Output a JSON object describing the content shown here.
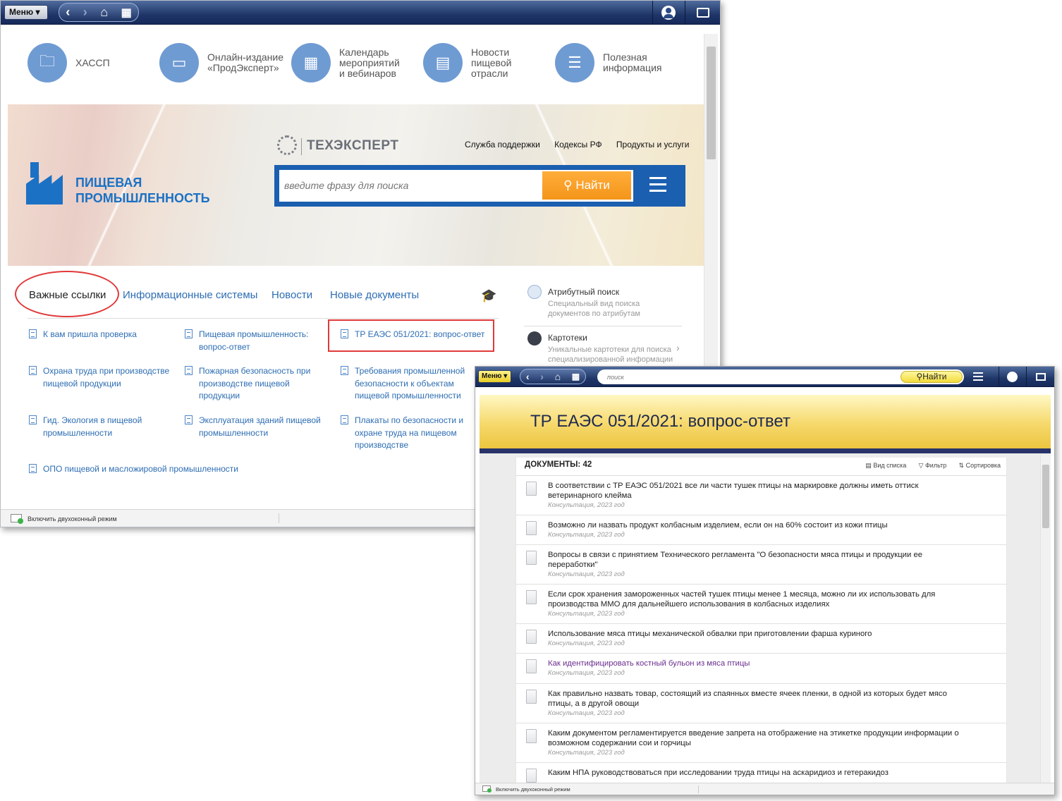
{
  "main_window": {
    "toolbar": {
      "menu_label": "Меню ▾",
      "back": "<",
      "forward": ">",
      "home": "⌂",
      "apps": "▦"
    },
    "tiles": [
      {
        "label": "ХАССП",
        "icon": "folders-icon"
      },
      {
        "label": "Онлайн-издание\n«ПродЭксперт»",
        "icon": "monitor-icon"
      },
      {
        "label": "Календарь\nмероприятий\nи вебинаров",
        "icon": "calendar-icon"
      },
      {
        "label": "Новости\nпищевой\nотрасли",
        "icon": "newspaper-icon"
      },
      {
        "label": "Полезная\nинформация",
        "icon": "info-doc-icon"
      }
    ],
    "banner": {
      "logo_text": "ТЕХЭКСПЕРТ",
      "top_links": [
        "Служба поддержки",
        "Кодексы РФ",
        "Продукты и услуги"
      ],
      "brand_line1": "ПИЩЕВАЯ",
      "brand_line2": "ПРОМЫШЛЕННОСТЬ",
      "search_placeholder": "введите фразу для поиска",
      "search_button": "Найти"
    },
    "tabs": [
      "Важные ссылки",
      "Информационные системы",
      "Новости",
      "Новые документы"
    ],
    "links": [
      "К вам пришла проверка",
      "Пищевая промышленность:\nвопрос-ответ",
      "ТР ЕАЭС 051/2021: вопрос-ответ",
      "Охрана труда при производстве\nпищевой продукции",
      "Пожарная безопасность при\nпроизводстве пищевой\nпродукции",
      "Требования промышленной\nбезопасности к объектам\nпищевой промышленности",
      "Гид. Экология в пищевой\nпромышленности",
      "Эксплуатация зданий пищевой\nпромышленности",
      "Плакаты по безопасности и\nохране труда на пищевом\nпроизводстве",
      "ОПО пищевой и масложировой промышленности"
    ],
    "right_panel": [
      {
        "title": "Атрибутный поиск",
        "sub": "Специальный вид поиска\nдокументов по атрибутам"
      },
      {
        "title": "Картотеки",
        "sub": "Уникальные картотеки для поиска\nспециализированной информации"
      }
    ],
    "status": "Включить двухоконный режим"
  },
  "doc_window": {
    "toolbar": {
      "menu_label": "Меню ▾",
      "search_placeholder": "поиск",
      "search_button": "Найти"
    },
    "title": "ТР ЕАЭС 051/2021: вопрос-ответ",
    "count_label": "ДОКУМЕНТЫ: 42",
    "tools": [
      "Вид списка",
      "Фильтр",
      "Сортировка"
    ],
    "documents": [
      {
        "title": "В соответствии с ТР ЕАЭС 051/2021 все ли части тушек птицы на маркировке должны иметь оттиск ветеринарного клейма",
        "meta": "Консультация, 2023 год"
      },
      {
        "title": "Возможно ли назвать продукт колбасным изделием, если он на 60% состоит из кожи птицы",
        "meta": "Консультация, 2023 год"
      },
      {
        "title": "Вопросы в связи с принятием Технического регламента \"О безопасности мяса птицы и продукции ее переработки\"",
        "meta": "Консультация, 2023 год"
      },
      {
        "title": "Если срок хранения замороженных частей тушек птицы менее 1 месяца, можно ли их использовать для производства ММО для дальнейшего использования в колбасных изделиях",
        "meta": "Консультация, 2023 год"
      },
      {
        "title": "Использование мяса птицы механической обвалки при приготовлении фарша куриного",
        "meta": "Консультация, 2023 год"
      },
      {
        "title": "Как идентифицировать костный бульон из мяса птицы",
        "meta": "Консультация, 2023 год"
      },
      {
        "title": "Как правильно назвать товар, состоящий из спаянных вместе ячеек пленки, в одной из которых будет мясо птицы, а в другой овощи",
        "meta": "Консультация, 2023 год"
      },
      {
        "title": "Каким документом регламентируется введение запрета на отображение на этикетке продукции информации о возможном содержании сои и горчицы",
        "meta": "Консультация, 2023 год"
      },
      {
        "title": "Каким НПА руководствоваться при исследовании труда птицы на аскаридиоз и гетеракидоз",
        "meta": ""
      }
    ],
    "visited_color": "#6b2d8f",
    "status": "Включить двухоконный режим"
  }
}
